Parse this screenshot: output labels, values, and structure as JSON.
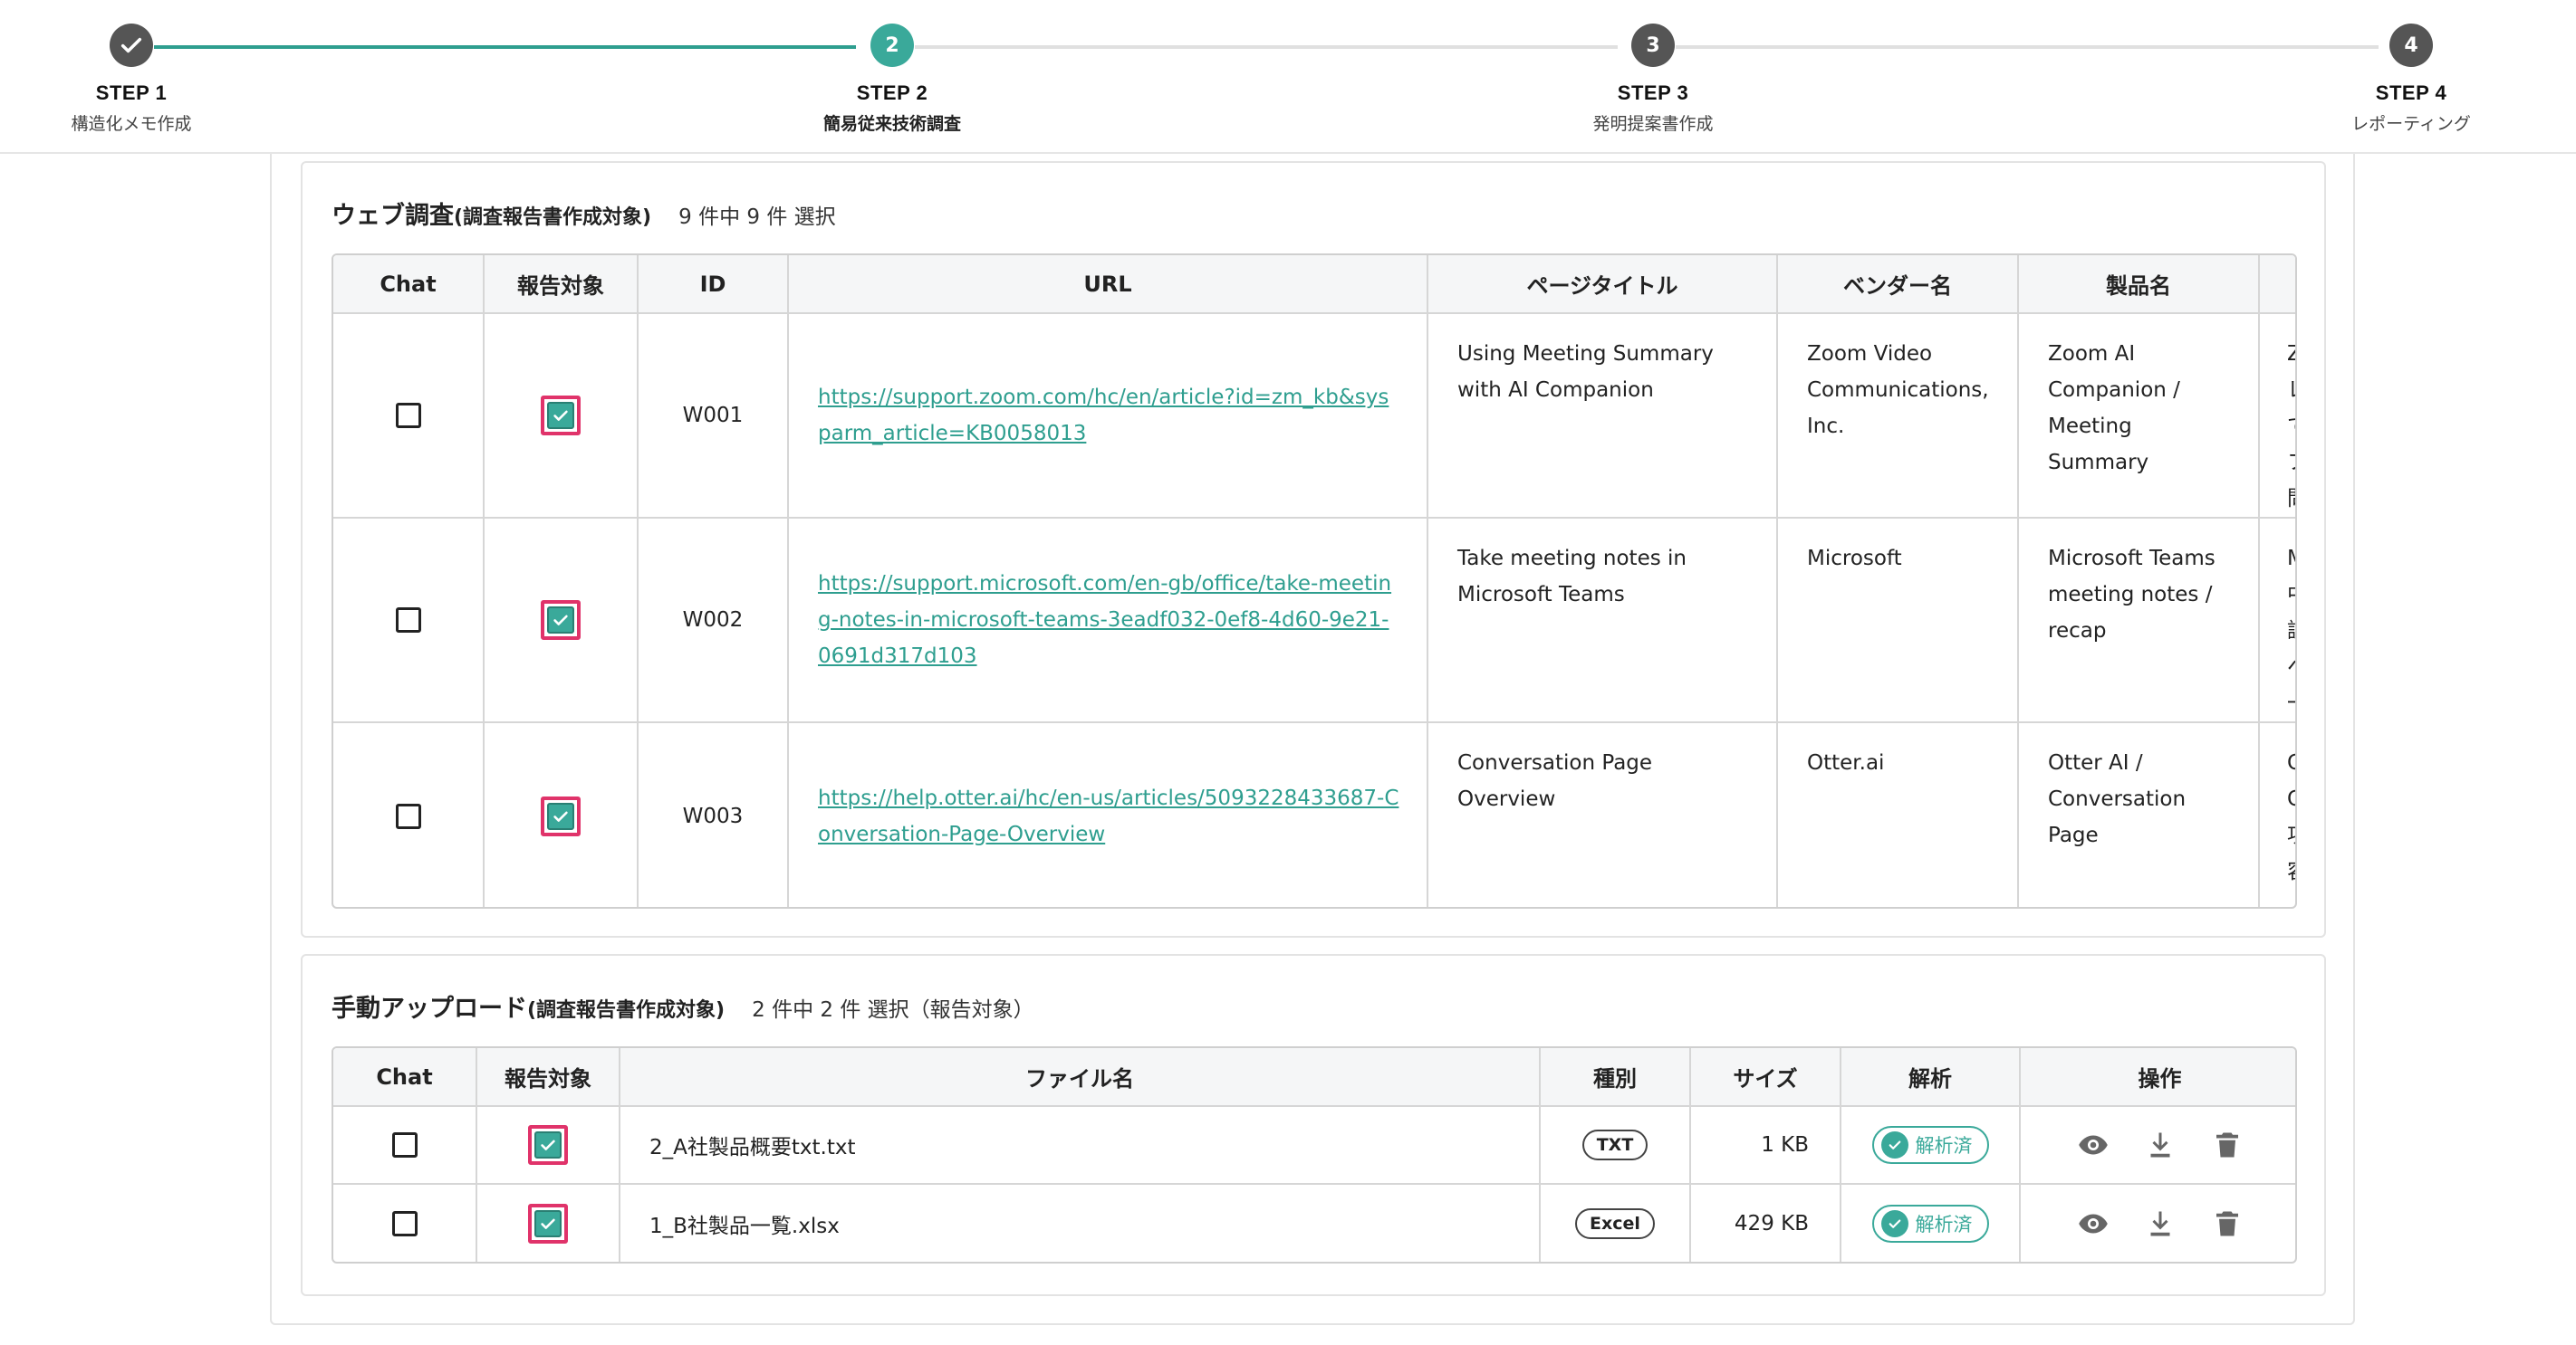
{
  "stepper": {
    "steps": [
      {
        "label": "STEP 1",
        "sub": "構造化メモ作成",
        "state": "done",
        "number": ""
      },
      {
        "label": "STEP 2",
        "sub": "簡易従来技術調査",
        "state": "active",
        "number": "2"
      },
      {
        "label": "STEP 3",
        "sub": "発明提案書作成",
        "state": "pending",
        "number": "3"
      },
      {
        "label": "STEP 4",
        "sub": "レポーティング",
        "state": "pending",
        "number": "4"
      }
    ]
  },
  "web": {
    "title": "ウェブ調査",
    "title_sub": "(調査報告書作成対象)",
    "count": "9 件中 9 件 選択",
    "columns": [
      "Chat",
      "報告対象",
      "ID",
      "URL",
      "ページタイトル",
      "ベンダー名",
      "製品名",
      ""
    ],
    "rows": [
      {
        "id": "W001",
        "url": "https://support.zoom.com/hc/en/article?id=zm_kb&sysparm_article=KB0058013",
        "page_title": "Using Meeting Summary with AI Companion",
        "vendor": "Zoom Video Communications, Inc.",
        "product": "Zoom AI Companion / Meeting Summary",
        "extra": "Z\nレ\nで\nフ\n問",
        "chat": false,
        "report": true
      },
      {
        "id": "W002",
        "url": "https://support.microsoft.com/en-gb/office/take-meeting-notes-in-microsoft-teams-3eadf032-0ef8-4d60-9e21-0691d317d103",
        "page_title": "Take meeting notes in Microsoft Teams",
        "vendor": "Microsoft",
        "product": "Microsoft Teams meeting notes / recap",
        "extra": "M\n中\n談\nへ\n一",
        "chat": false,
        "report": true
      },
      {
        "id": "W003",
        "url": "https://help.otter.ai/hc/en-us/articles/5093228433687-Conversation-Page-Overview",
        "page_title": "Conversation Page Overview",
        "vendor": "Otter.ai",
        "product": "Otter AI / Conversation Page",
        "extra": "C\nC\n項\n容",
        "chat": false,
        "report": true
      }
    ]
  },
  "upload": {
    "title": "手動アップロード",
    "title_sub": "(調査報告書作成対象)",
    "count": "2 件中 2 件 選択（報告対象）",
    "columns": [
      "Chat",
      "報告対象",
      "ファイル名",
      "種別",
      "サイズ",
      "解析",
      "操作"
    ],
    "rows": [
      {
        "filename": "2_A社製品概要txt.txt",
        "type": "TXT",
        "size": "1 KB",
        "status": "解析済",
        "chat": false,
        "report": true
      },
      {
        "filename": "1_B社製品一覧.xlsx",
        "type": "Excel",
        "size": "429 KB",
        "status": "解析済",
        "chat": false,
        "report": true
      }
    ]
  },
  "icons": {
    "check": "check-icon",
    "view": "eye-icon",
    "download": "download-icon",
    "delete": "trash-icon"
  },
  "colors": {
    "accent": "#3aa99a",
    "highlight": "#e0336a",
    "step_done": "#555555"
  }
}
